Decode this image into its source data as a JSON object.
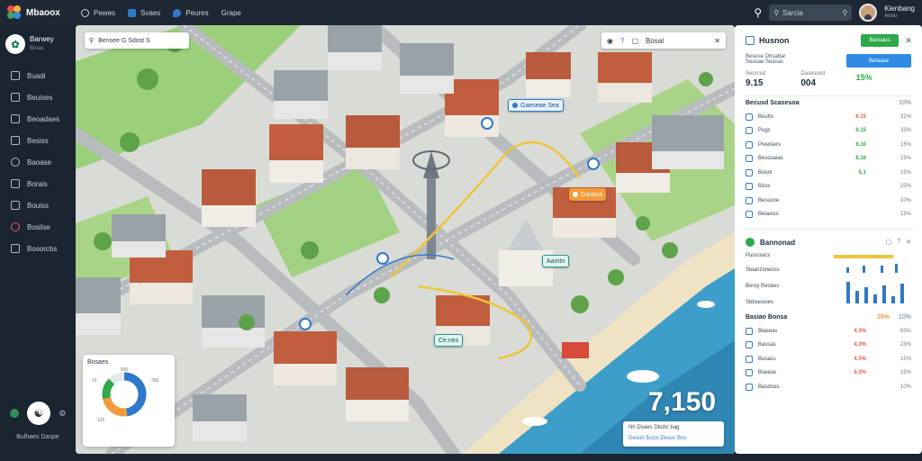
{
  "app": {
    "brand": "Mbaoox",
    "nav": [
      {
        "label": "Pewes",
        "icon": "clock-icon"
      },
      {
        "label": "Svaes",
        "icon": "grid-icon"
      },
      {
        "label": "Peures",
        "icon": "pin-icon"
      },
      {
        "label": "Grape",
        "icon": "chart-icon"
      }
    ],
    "search_placeholder": "Sarcia",
    "user_name": "Kienbang",
    "user_sub": "Annu"
  },
  "sidebar": {
    "profile_title": "Barwey",
    "profile_sub": "Broas",
    "items": [
      {
        "label": "Buadi",
        "icon": "home-icon"
      },
      {
        "label": "Beuises",
        "icon": "layers-icon"
      },
      {
        "label": "Beoadaes",
        "icon": "briefcase-icon"
      },
      {
        "label": "Besiss",
        "icon": "document-icon"
      },
      {
        "label": "Baoase",
        "icon": "users-icon"
      },
      {
        "label": "Borais",
        "icon": "calendar-icon"
      },
      {
        "label": "Bouiss",
        "icon": "cart-icon"
      },
      {
        "label": "Bosilse",
        "icon": "target-icon"
      },
      {
        "label": "Bosorcbs",
        "icon": "settings-icon"
      }
    ],
    "footer": "Bulhaes Daspe"
  },
  "map": {
    "search_text": "Bensee  G  Sdost  S",
    "tools_label": "Bosal",
    "pins": [
      {
        "label": "Gaeseae Sea",
        "kind": "blue"
      },
      {
        "label": "Ganess",
        "kind": "orange"
      },
      {
        "label": "Aamtn",
        "kind": "teal"
      },
      {
        "label": "Ce.nes",
        "kind": "teal"
      }
    ],
    "donut_title": "Bosaes",
    "donut_labels": [
      "500",
      "250",
      "15",
      "125"
    ],
    "big_stat": "7,150",
    "stat_line_1": "Nh  Doaes  Dbslic  bag",
    "stat_line_2": "Geson 5ctos  Desoc  Bos",
    "colors": {
      "land": "#d9dcd6",
      "grass": "#9bcf7a",
      "water": "#3d9fc9",
      "sand": "#efe3c4",
      "roof": "#b85a3c",
      "road": "#b9bcbf"
    }
  },
  "panel": {
    "title": "Husnon",
    "green_button": "Bassaus",
    "subtitle": "Besese Dhsabar",
    "subtitle_2": "Seusae Seasas",
    "blue_button": "Betaase",
    "metrics": [
      {
        "label": "Seorcsd",
        "value": "9.15",
        "accent": "dark"
      },
      {
        "label": "Dasesosrt",
        "value": "004",
        "accent": "dark"
      },
      {
        "label": "",
        "value": "15%",
        "accent": "green"
      }
    ],
    "table": {
      "header": "Becusd Scasesoa",
      "header_right": "10%",
      "rows": [
        {
          "label": "Bouhs",
          "a": "6.15",
          "b": "32%"
        },
        {
          "label": "Pugs",
          "a": "6.15",
          "b": "33%"
        },
        {
          "label": "Prewsers",
          "a": "6.10",
          "b": "15%"
        },
        {
          "label": "Besosaias",
          "a": "6.16",
          "b": "15%"
        },
        {
          "label": "Boeni",
          "a": "5.1",
          "b": "15%"
        },
        {
          "label": "Bzos",
          "a": "",
          "b": "25%"
        },
        {
          "label": "Besusne",
          "a": "",
          "b": "10%"
        },
        {
          "label": "Beiaoiss",
          "a": "",
          "b": "15%"
        }
      ]
    },
    "section": {
      "title": "Bannonad",
      "lines": [
        "Puisrosics",
        "Sieanzoneoss",
        "Borsy Resbes",
        "Sbbsesioes"
      ]
    },
    "table2": {
      "header": "Basiao Bonsa",
      "header_mid": "39%",
      "header_right": "10%",
      "rows": [
        {
          "label": "Biaseas",
          "a": "4.3%",
          "b": "83%"
        },
        {
          "label": "Bassas",
          "a": "4.3%",
          "b": "23%"
        },
        {
          "label": "Busacs",
          "a": "4.3%",
          "b": "15%"
        },
        {
          "label": "Bseese",
          "a": "5.3%",
          "b": "15%"
        },
        {
          "label": "Basdnos",
          "a": "",
          "b": "10%"
        }
      ]
    }
  }
}
